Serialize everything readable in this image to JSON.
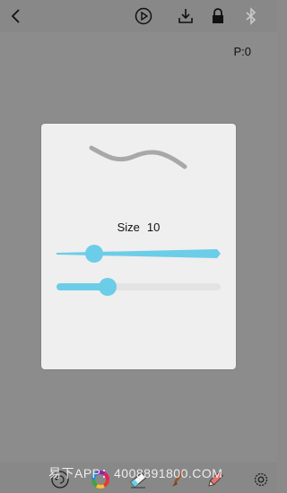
{
  "header": {
    "page_counter": "P:0"
  },
  "pen_dialog": {
    "size_label": "Size",
    "size_value": "10",
    "size_slider": {
      "level": 0.23
    },
    "opacity_slider": {
      "level": 0.31
    },
    "accent_color": "#6ccde8",
    "preview_stroke_color": "#a8a8a8"
  },
  "footer": {
    "watermark_text": "易下APP：4008891800.COM"
  },
  "icons": {
    "top": [
      "back-icon",
      "play-icon",
      "download-icon",
      "lock-icon",
      "bluetooth-icon"
    ],
    "bottom": [
      "undo-icon",
      "color-wheel-icon",
      "eraser-icon",
      "brush-icon",
      "pencil-icon",
      "settings-icon"
    ]
  }
}
